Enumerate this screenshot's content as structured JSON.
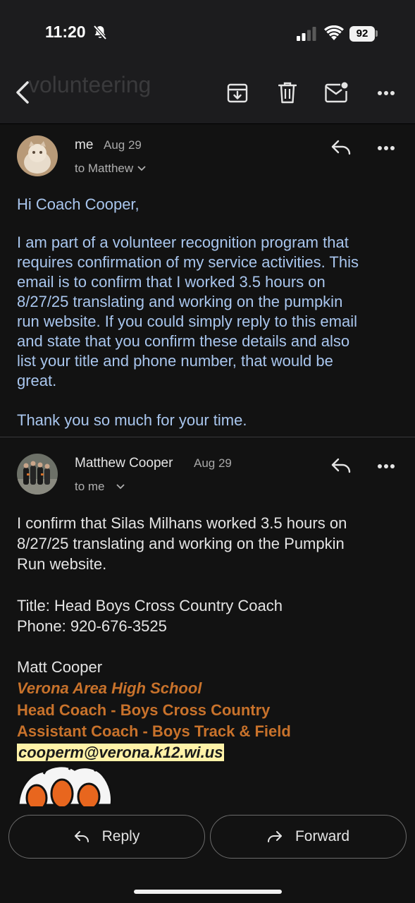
{
  "status_bar": {
    "time": "11:20",
    "battery": "92"
  },
  "toolbar": {
    "title": "volunteering",
    "icons": [
      "back-icon",
      "archive-icon",
      "trash-icon",
      "mark-unread-icon",
      "more-icon"
    ]
  },
  "messages": [
    {
      "sender": "me",
      "date": "Aug 29",
      "to_line": "to Matthew",
      "body": [
        "Hi Coach Cooper,",
        "I am part of a volunteer recognition program that",
        "requires confirmation of my service activities. This",
        "email is to confirm that I worked 3.5 hours on",
        "8/27/25 translating and working on the pumpkin",
        "run website. If you could simply reply to this email",
        "and state that you confirm these details and also",
        "list your title and phone number, that would be",
        "great.",
        "Thank you so much for your time."
      ]
    },
    {
      "sender": "Matthew Cooper",
      "date": "Aug 29",
      "to_line": "to me",
      "body": [
        "I confirm that Silas Milhans worked 3.5 hours on",
        "8/27/25 translating and working on the Pumpkin",
        "Run website.",
        "Title: Head Boys Cross Country Coach",
        "Phone: 920-676-3525",
        "Matt Cooper"
      ],
      "signature": {
        "school": "Verona Area High School",
        "role1": "Head Coach - Boys Cross Country",
        "role2": "Assistant Coach - Boys Track & Field",
        "email": "cooperm@verona.k12.wi.us"
      }
    }
  ],
  "actions": {
    "reply": "Reply",
    "forward": "Forward"
  },
  "colors": {
    "accent_body": "#a9c6ee",
    "signature": "#c8722b",
    "highlight": "#fff2a8",
    "background": "#121212"
  }
}
